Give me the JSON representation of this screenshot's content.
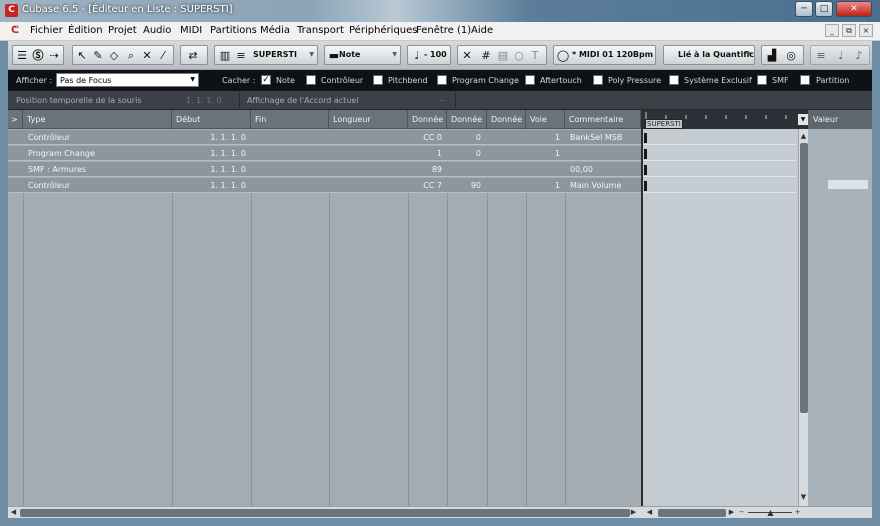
{
  "window": {
    "title": "Cubase 6.5 - [Éditeur en Liste : SUPERSTI]",
    "controls": [
      "─",
      "□",
      "✕"
    ]
  },
  "menu": {
    "items": [
      "Fichier",
      "Édition",
      "Projet",
      "Audio",
      "MIDI",
      "Partitions",
      "Média",
      "Transport",
      "Périphériques",
      "Fenêtre (1)",
      "Aide"
    ],
    "doc_controls": [
      "_",
      "⧉",
      "×"
    ]
  },
  "toolbar": {
    "part_name": "SUPERSTI",
    "insert_type": "Note",
    "velocity": "100",
    "midi_input": "* MIDI 01  120Bpm",
    "quantize_link": "Lié à la Quantific",
    "icons": [
      "inspector-icon",
      "solo-icon",
      "autoscroll-icon",
      "arrow-icon",
      "pencil-icon",
      "eraser-icon",
      "zoom-icon",
      "mute-icon",
      "trim-icon",
      "snap-icon",
      "track-select-icon",
      "part-icon",
      "velocity-icon",
      "xmit-icon",
      "grid-icon",
      "quantize-icon",
      "midi-icon",
      "bar-icon",
      "metronome-icon"
    ]
  },
  "filter": {
    "show_label": "Afficher :",
    "show_value": "Pas de Focus",
    "hide_label": "Cacher :",
    "options": [
      {
        "label": "Note",
        "checked": true
      },
      {
        "label": "Contrôleur",
        "checked": false
      },
      {
        "label": "Pitchbend",
        "checked": false
      },
      {
        "label": "Program Change",
        "checked": false
      },
      {
        "label": "Aftertouch",
        "checked": false
      },
      {
        "label": "Poly Pressure",
        "checked": false
      },
      {
        "label": "Système Exclusif",
        "checked": false
      },
      {
        "label": "SMF",
        "checked": false
      },
      {
        "label": "Partition",
        "checked": false
      }
    ]
  },
  "info": {
    "mouse_pos_label": "Position temporelle de la souris",
    "mouse_pos_value": "1.  1.  1.    0",
    "chord_label": "Affichage de l'Accord actuel",
    "chord_value": "--"
  },
  "columns": [
    "Type",
    "Début",
    "Fin",
    "Longueur",
    "Donnée",
    "Donnée",
    "Donnée",
    "Voie",
    "Commentaire"
  ],
  "rows": [
    {
      "type": "Contrôleur",
      "start": "1.  1.  1.    0",
      "end": "",
      "length": "",
      "d1": "CC 0",
      "d2": "0",
      "d3": "",
      "channel": "1",
      "comment": "BankSel MSB"
    },
    {
      "type": "Program Change",
      "start": "1.  1.  1.    0",
      "end": "",
      "length": "",
      "d1": "1",
      "d2": "0",
      "d3": "",
      "channel": "1",
      "comment": ""
    },
    {
      "type": "SMF : Armures",
      "start": "1.  1.  1.    0",
      "end": "",
      "length": "",
      "d1": "89",
      "d2": "",
      "d3": "",
      "channel": "",
      "comment": "00,00"
    },
    {
      "type": "Contrôleur",
      "start": "1.  1.  1.    0",
      "end": "",
      "length": "",
      "d1": "CC 7",
      "d2": "90",
      "d3": "",
      "channel": "1",
      "comment": "Main Volume"
    }
  ],
  "event_pane": {
    "part_label": "SUPERSTI"
  },
  "value_pane": {
    "header": "Valeur"
  }
}
